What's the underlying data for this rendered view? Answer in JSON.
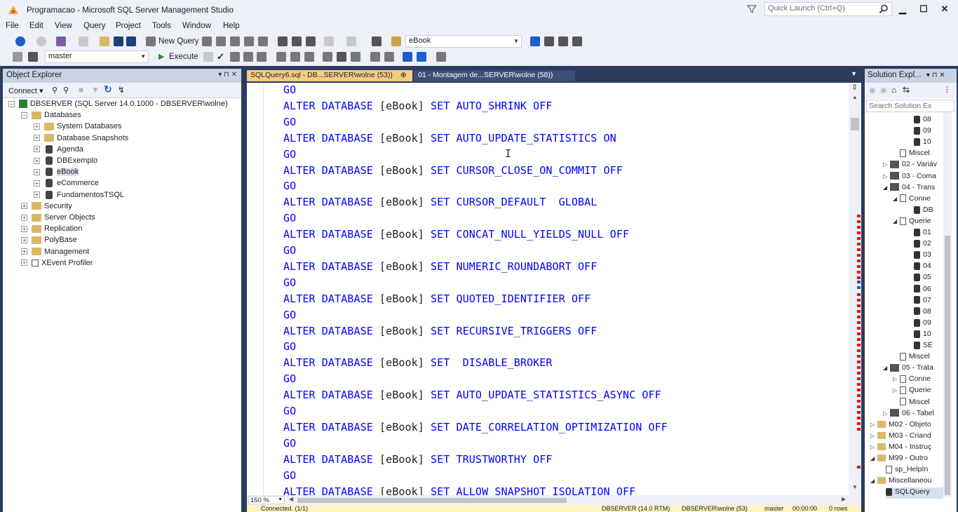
{
  "window": {
    "title": "Programacao - Microsoft SQL Server Management Studio",
    "quick_launch_placeholder": "Quick Launch (Ctrl+Q)",
    "min_glyph": "▁",
    "max_glyph": "☐",
    "close_glyph": "✕"
  },
  "menu": [
    "File",
    "Edit",
    "View",
    "Query",
    "Project",
    "Tools",
    "Window",
    "Help"
  ],
  "toolbar": {
    "new_query_label": "New Query",
    "database_combo_value": "eBook",
    "db_selector_value": "master",
    "execute_label": "Execute"
  },
  "object_explorer": {
    "title": "Object Explorer",
    "header_buttons": "▾ ⊓ ✕",
    "connect_label": "Connect ▾",
    "tree": [
      {
        "level": 0,
        "expander": "−",
        "icon": "server",
        "label": "DBSERVER (SQL Server 14.0.1000 - DBSERVER\\wolne)"
      },
      {
        "level": 1,
        "expander": "−",
        "icon": "folder",
        "label": "Databases"
      },
      {
        "level": 2,
        "expander": "+",
        "icon": "folder",
        "label": "System Databases"
      },
      {
        "level": 2,
        "expander": "+",
        "icon": "folder",
        "label": "Database Snapshots"
      },
      {
        "level": 2,
        "expander": "+",
        "icon": "db",
        "label": "Agenda"
      },
      {
        "level": 2,
        "expander": "+",
        "icon": "db",
        "label": "DBExemplo"
      },
      {
        "level": 2,
        "expander": "+",
        "icon": "db",
        "label": "eBook",
        "selected": true
      },
      {
        "level": 2,
        "expander": "+",
        "icon": "db",
        "label": "eCommerce"
      },
      {
        "level": 2,
        "expander": "+",
        "icon": "db",
        "label": "FundamentosTSQL"
      },
      {
        "level": 1,
        "expander": "+",
        "icon": "folder",
        "label": "Security"
      },
      {
        "level": 1,
        "expander": "+",
        "icon": "folder",
        "label": "Server Objects"
      },
      {
        "level": 1,
        "expander": "+",
        "icon": "folder",
        "label": "Replication"
      },
      {
        "level": 1,
        "expander": "+",
        "icon": "folder",
        "label": "PolyBase"
      },
      {
        "level": 1,
        "expander": "+",
        "icon": "folder",
        "label": "Management"
      },
      {
        "level": 1,
        "expander": "+",
        "icon": "xevent",
        "label": "XEvent Profiler"
      }
    ]
  },
  "tabs": {
    "active": "SQLQuery6.sql - DB...SERVER\\wolne (53))",
    "active_pin": "⊕",
    "active_close": "✕",
    "inactive": "01 - Montagem de...SERVER\\wolne (58))"
  },
  "editor": {
    "lines": [
      {
        "kw": "GO"
      },
      {
        "kw": "ALTER DATABASE ",
        "br": "[eBook]",
        "rest": " SET AUTO_SHRINK OFF"
      },
      {
        "kw": "GO"
      },
      {
        "kw": "ALTER DATABASE ",
        "br": "[eBook]",
        "rest": " SET AUTO_UPDATE_STATISTICS ON"
      },
      {
        "kw": "GO"
      },
      {
        "kw": "ALTER DATABASE ",
        "br": "[eBook]",
        "rest": " SET CURSOR_CLOSE_ON_COMMIT OFF"
      },
      {
        "kw": "GO"
      },
      {
        "kw": "ALTER DATABASE ",
        "br": "[eBook]",
        "rest": " SET CURSOR_DEFAULT  GLOBAL"
      },
      {
        "kw": "GO"
      },
      {
        "kw": "ALTER DATABASE ",
        "br": "[eBook]",
        "rest": " SET CONCAT_NULL_YIELDS_NULL OFF"
      },
      {
        "kw": "GO"
      },
      {
        "kw": "ALTER DATABASE ",
        "br": "[eBook]",
        "rest": " SET NUMERIC_ROUNDABORT OFF"
      },
      {
        "kw": "GO"
      },
      {
        "kw": "ALTER DATABASE ",
        "br": "[eBook]",
        "rest": " SET QUOTED_IDENTIFIER OFF"
      },
      {
        "kw": "GO"
      },
      {
        "kw": "ALTER DATABASE ",
        "br": "[eBook]",
        "rest": " SET RECURSIVE_TRIGGERS OFF"
      },
      {
        "kw": "GO"
      },
      {
        "kw": "ALTER DATABASE ",
        "br": "[eBook]",
        "rest": " SET  DISABLE_BROKER"
      },
      {
        "kw": "GO"
      },
      {
        "kw": "ALTER DATABASE ",
        "br": "[eBook]",
        "rest": " SET AUTO_UPDATE_STATISTICS_ASYNC OFF"
      },
      {
        "kw": "GO"
      },
      {
        "kw": "ALTER DATABASE ",
        "br": "[eBook]",
        "rest": " SET DATE_CORRELATION_OPTIMIZATION OFF"
      },
      {
        "kw": "GO"
      },
      {
        "kw": "ALTER DATABASE ",
        "br": "[eBook]",
        "rest": " SET TRUSTWORTHY OFF"
      },
      {
        "kw": "GO"
      },
      {
        "kw": "ALTER DATABASE ",
        "br": "[eBook]",
        "rest": " SET ALLOW_SNAPSHOT_ISOLATION OFF"
      }
    ],
    "zoom": "150 %"
  },
  "status": {
    "connected": "Connected. (1/1)",
    "server": "DBSERVER (14.0 RTM)",
    "user": "DBSERVER\\wolne (53)",
    "database": "master",
    "time": "00:00:00",
    "rows": "0 rows"
  },
  "solution_explorer": {
    "title": "Solution Expl...",
    "header_buttons": "▾ ⊓ ✕",
    "search_placeholder": "Search Solution Ex",
    "rows": [
      {
        "indent": 70,
        "tri": "",
        "icon": "db",
        "label": "08"
      },
      {
        "indent": 70,
        "tri": "",
        "icon": "db",
        "label": "09"
      },
      {
        "indent": 70,
        "tri": "",
        "icon": "db",
        "label": "10"
      },
      {
        "indent": 50,
        "tri": "",
        "icon": "doc",
        "label": "Miscel"
      },
      {
        "indent": 26,
        "tri": "▷",
        "icon": "proj",
        "label": "02 - Variáv"
      },
      {
        "indent": 26,
        "tri": "▷",
        "icon": "proj",
        "label": "03 - Coma"
      },
      {
        "indent": 26,
        "tri": "◢",
        "icon": "proj",
        "label": "04 - Trans"
      },
      {
        "indent": 40,
        "tri": "◢",
        "icon": "doc",
        "label": "Conne"
      },
      {
        "indent": 70,
        "tri": "",
        "icon": "db",
        "label": "DB"
      },
      {
        "indent": 40,
        "tri": "◢",
        "icon": "doc",
        "label": "Querie"
      },
      {
        "indent": 70,
        "tri": "",
        "icon": "db",
        "label": "01"
      },
      {
        "indent": 70,
        "tri": "",
        "icon": "db",
        "label": "02"
      },
      {
        "indent": 70,
        "tri": "",
        "icon": "db",
        "label": "03"
      },
      {
        "indent": 70,
        "tri": "",
        "icon": "db",
        "label": "04"
      },
      {
        "indent": 70,
        "tri": "",
        "icon": "db",
        "label": "05"
      },
      {
        "indent": 70,
        "tri": "",
        "icon": "db",
        "label": "06"
      },
      {
        "indent": 70,
        "tri": "",
        "icon": "db",
        "label": "07"
      },
      {
        "indent": 70,
        "tri": "",
        "icon": "db",
        "label": "08"
      },
      {
        "indent": 70,
        "tri": "",
        "icon": "db",
        "label": "09"
      },
      {
        "indent": 70,
        "tri": "",
        "icon": "db",
        "label": "10"
      },
      {
        "indent": 70,
        "tri": "",
        "icon": "db",
        "label": "SE"
      },
      {
        "indent": 50,
        "tri": "",
        "icon": "doc",
        "label": "Miscel"
      },
      {
        "indent": 26,
        "tri": "◢",
        "icon": "proj",
        "label": "05 - Trata"
      },
      {
        "indent": 40,
        "tri": "▷",
        "icon": "doc",
        "label": "Conne"
      },
      {
        "indent": 40,
        "tri": "▷",
        "icon": "doc",
        "label": "Querie"
      },
      {
        "indent": 50,
        "tri": "",
        "icon": "doc",
        "label": "Miscel"
      },
      {
        "indent": 26,
        "tri": "▷",
        "icon": "proj",
        "label": "06 - Tabel"
      },
      {
        "indent": 8,
        "tri": "▷",
        "icon": "fold",
        "label": "M02 - Objeto"
      },
      {
        "indent": 8,
        "tri": "▷",
        "icon": "fold",
        "label": "M03 - Criand"
      },
      {
        "indent": 8,
        "tri": "▷",
        "icon": "fold",
        "label": "M04 - Instruç"
      },
      {
        "indent": 8,
        "tri": "◢",
        "icon": "fold",
        "label": "M99 - Outro"
      },
      {
        "indent": 30,
        "tri": "",
        "icon": "doc",
        "label": "sp_HelpIn"
      },
      {
        "indent": 8,
        "tri": "◢",
        "icon": "fold",
        "label": "Miscellaneou"
      },
      {
        "indent": 30,
        "tri": "",
        "icon": "db",
        "label": "SQLQuery",
        "selected": true
      }
    ]
  }
}
